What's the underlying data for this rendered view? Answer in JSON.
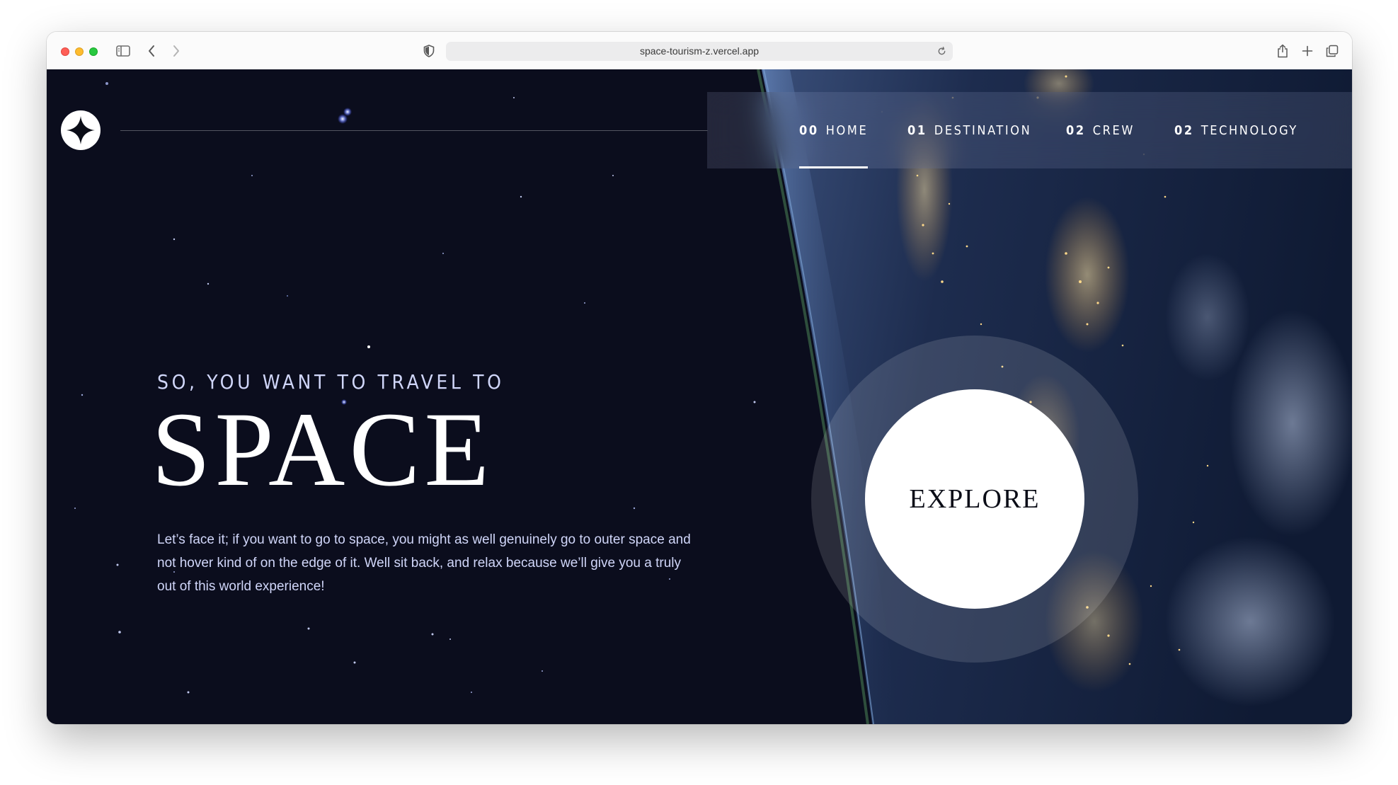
{
  "browser": {
    "url": "space-tourism-z.vercel.app"
  },
  "nav": {
    "items": [
      {
        "number": "00",
        "label": "HOME",
        "active": true
      },
      {
        "number": "01",
        "label": "DESTINATION",
        "active": false
      },
      {
        "number": "02",
        "label": "CREW",
        "active": false
      },
      {
        "number": "02",
        "label": "TECHNOLOGY",
        "active": false
      }
    ]
  },
  "hero": {
    "eyebrow": "SO, YOU WANT TO TRAVEL TO",
    "title": "SPACE",
    "body": "Let’s face it; if you want to go to space, you might as well genuinely go to outer space and not hover kind of on the edge of it. Well sit back, and relax because we’ll give you a truly out of this world experience!",
    "cta_label": "EXPLORE"
  },
  "colors": {
    "background": "#0b0d1d",
    "accent_text": "#d0d6f9",
    "white": "#ffffff"
  },
  "icons": {
    "logo": "four-point-star-icon",
    "sidebar": "sidebar-toggle-icon",
    "back": "chevron-left-icon",
    "forward": "chevron-right-icon",
    "privacy": "shield-icon",
    "reload": "reload-icon",
    "share": "share-icon",
    "new_tab": "plus-icon",
    "tabs": "tab-overview-icon"
  }
}
